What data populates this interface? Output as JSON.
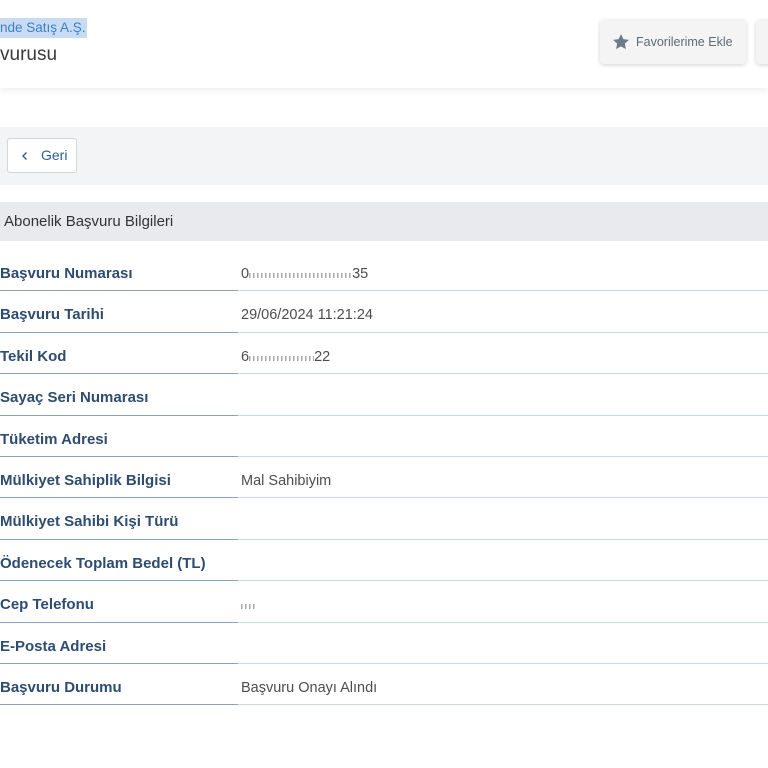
{
  "header": {
    "org_name_fragment": "nde Satış A.Ş.",
    "title_fragment": "vurusu",
    "favorite_button": {
      "label": "Favorilerime Ekle",
      "icon": "star-icon"
    }
  },
  "toolbar": {
    "back_button": {
      "label": "Geri",
      "icon": "chevron-left-icon"
    }
  },
  "section": {
    "title": "Abonelik Başvuru Bilgileri",
    "rows": [
      {
        "label": "Başvuru Numarası",
        "value": {
          "prefix": "0",
          "suffix": "35",
          "masked": true
        }
      },
      {
        "label": "Başvuru Tarihi",
        "value": "29/06/2024 11:21:24"
      },
      {
        "label": "Tekil Kod",
        "value": {
          "prefix": "6",
          "suffix": "22",
          "masked": true
        }
      },
      {
        "label": "Sayaç Seri Numarası",
        "value": ""
      },
      {
        "label": "Tüketim Adresi",
        "value": ""
      },
      {
        "label": "Mülkiyet Sahiplik Bilgisi",
        "value": "Mal Sahibiyim"
      },
      {
        "label": "Mülkiyet Sahibi Kişi Türü",
        "value": ""
      },
      {
        "label": "Ödenecek Toplam Bedel (TL)",
        "value": ""
      },
      {
        "label": "Cep Telefonu",
        "value": {
          "masked": true
        }
      },
      {
        "label": "E-Posta Adresi",
        "value": ""
      },
      {
        "label": "Başvuru Durumu",
        "value": "Başvuru Onayı Alındı"
      }
    ]
  },
  "colors": {
    "label_text": "#2d4c70",
    "link_blue": "#2f5d8f",
    "selection_highlight": "#c7dcf3",
    "section_header_bg": "#e8eaed"
  }
}
